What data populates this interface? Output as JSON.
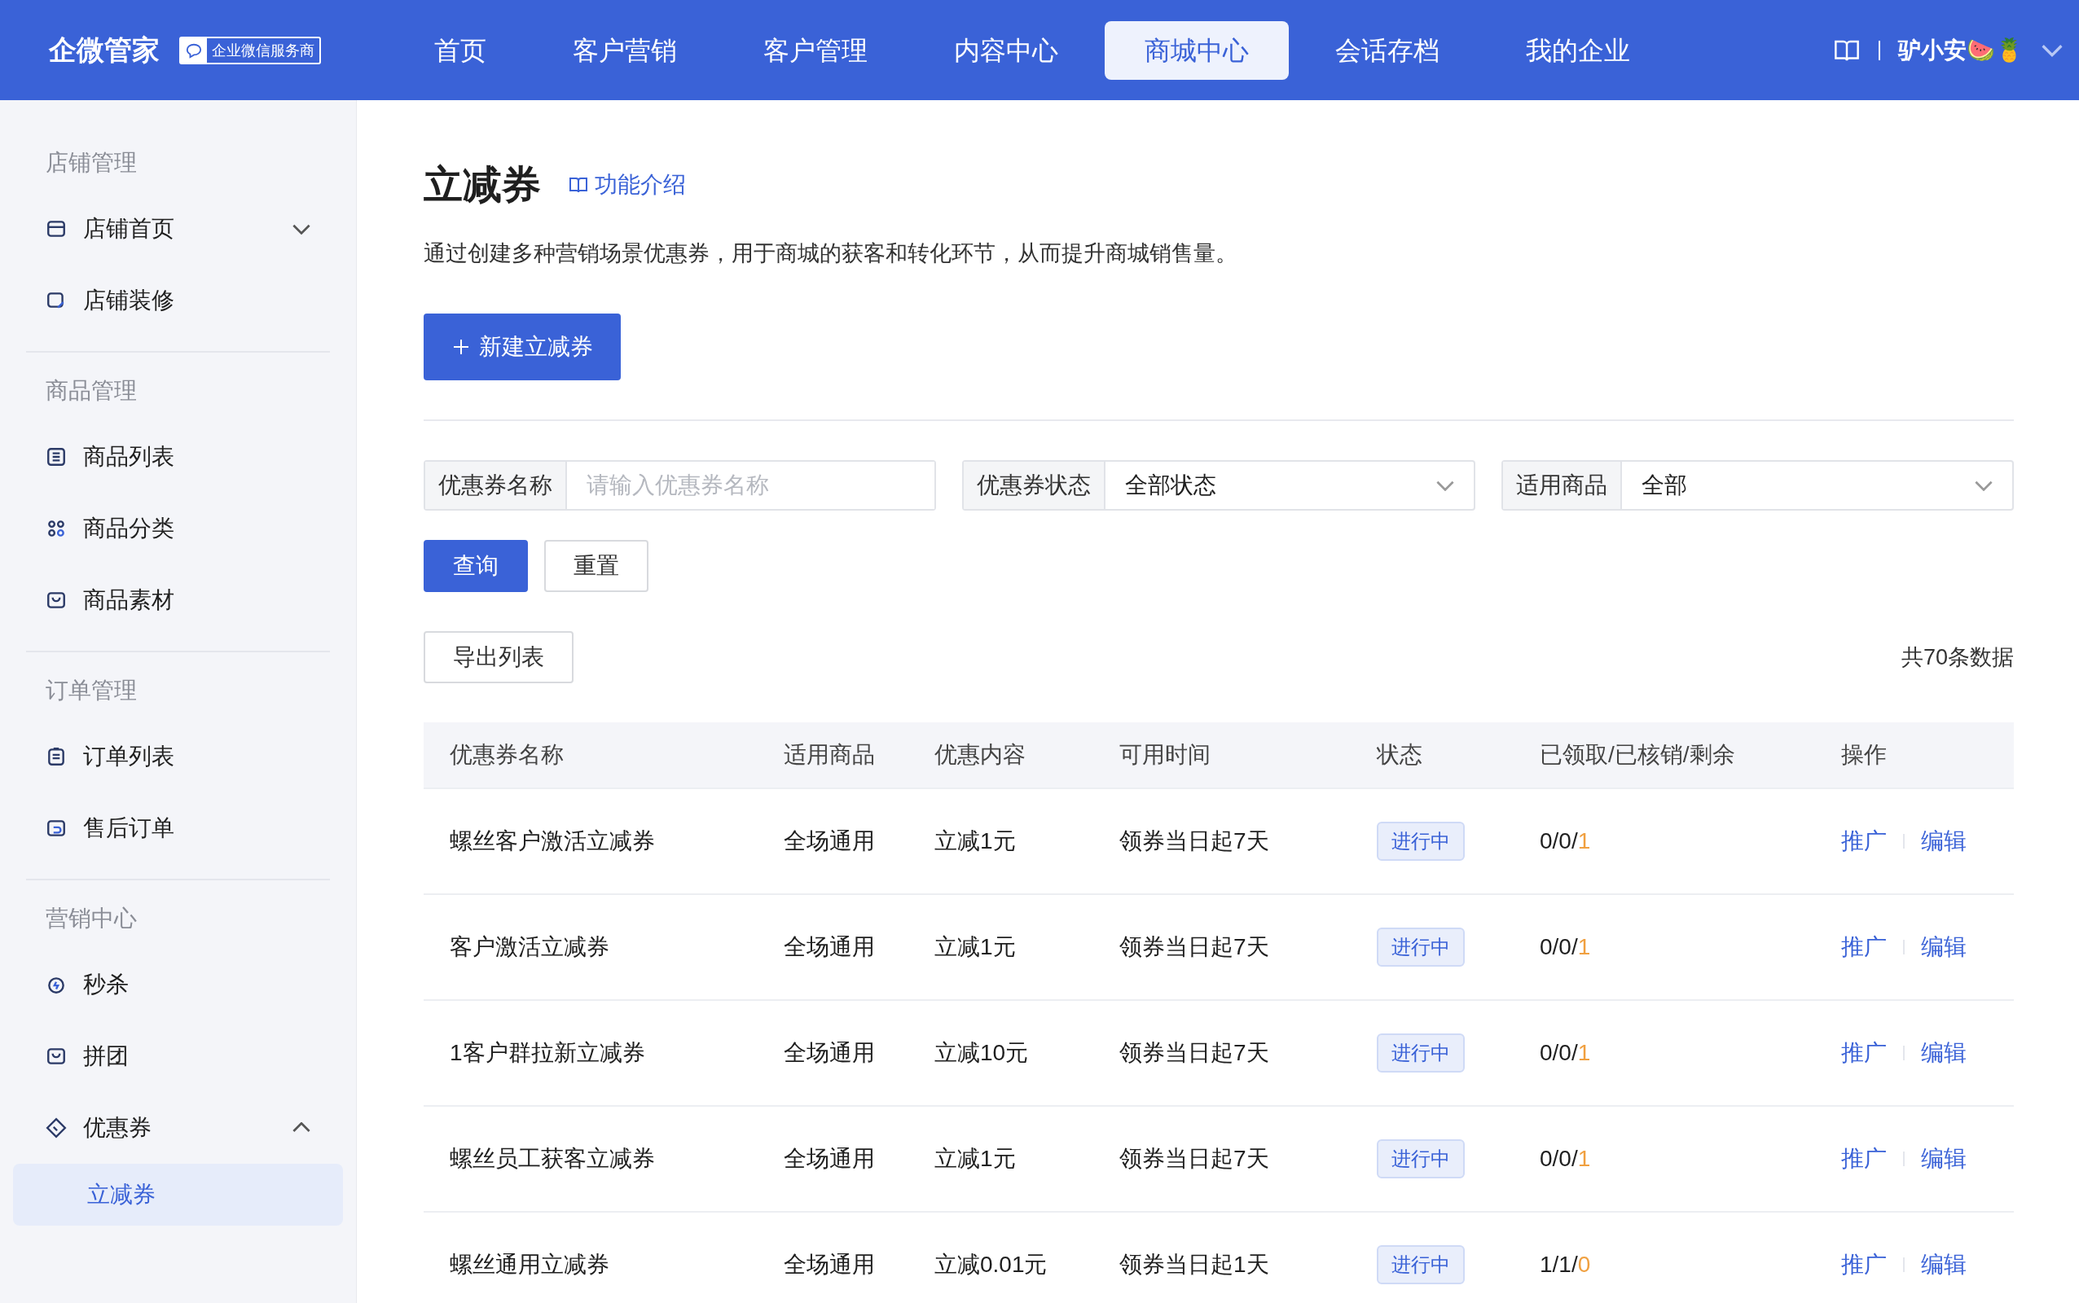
{
  "header": {
    "brand": "企微管家",
    "badge": "企业微信服务商",
    "nav": [
      {
        "label": "首页",
        "selected": false
      },
      {
        "label": "客户营销",
        "selected": false
      },
      {
        "label": "客户管理",
        "selected": false
      },
      {
        "label": "内容中心",
        "selected": false
      },
      {
        "label": "商城中心",
        "selected": true
      },
      {
        "label": "会话存档",
        "selected": false
      },
      {
        "label": "我的企业",
        "selected": false
      }
    ],
    "user": "驴小安🍉🍍"
  },
  "sidebar": {
    "sections": [
      {
        "title": "店铺管理",
        "items": [
          {
            "label": "店铺首页",
            "expanded": false
          },
          {
            "label": "店铺装修"
          }
        ]
      },
      {
        "title": "商品管理",
        "items": [
          {
            "label": "商品列表"
          },
          {
            "label": "商品分类"
          },
          {
            "label": "商品素材"
          }
        ]
      },
      {
        "title": "订单管理",
        "items": [
          {
            "label": "订单列表"
          },
          {
            "label": "售后订单"
          }
        ]
      },
      {
        "title": "营销中心",
        "items": [
          {
            "label": "秒杀"
          },
          {
            "label": "拼团"
          },
          {
            "label": "优惠券",
            "expanded": true,
            "children": [
              {
                "label": "立减券",
                "selected": true
              }
            ]
          }
        ]
      }
    ]
  },
  "page": {
    "title": "立减券",
    "intro_link": "功能介绍",
    "description": "通过创建多种营销场景优惠券，用于商城的获客和转化环节，从而提升商城销售量。",
    "create_button": "新建立减券",
    "filters": [
      {
        "label": "优惠券名称",
        "kind": "input",
        "placeholder": "请输入优惠券名称"
      },
      {
        "label": "优惠券状态",
        "kind": "select",
        "value": "全部状态"
      },
      {
        "label": "适用商品",
        "kind": "select",
        "value": "全部"
      }
    ],
    "query_button": "查询",
    "reset_button": "重置",
    "export_button": "导出列表",
    "total": "共70条数据",
    "table": {
      "columns": [
        "优惠券名称",
        "适用商品",
        "优惠内容",
        "可用时间",
        "状态",
        "已领取/已核销/剩余",
        "操作"
      ],
      "rows": [
        {
          "name": "螺丝客户激活立减券",
          "goods": "全场通用",
          "content": "立减1元",
          "time": "领券当日起7天",
          "status": "进行中",
          "usage": "0/0/",
          "remaining": "1",
          "actions": [
            "推广",
            "编辑"
          ]
        },
        {
          "name": "客户激活立减券",
          "goods": "全场通用",
          "content": "立减1元",
          "time": "领券当日起7天",
          "status": "进行中",
          "usage": "0/0/",
          "remaining": "1",
          "actions": [
            "推广",
            "编辑"
          ]
        },
        {
          "name": "1客户群拉新立减券",
          "goods": "全场通用",
          "content": "立减10元",
          "time": "领券当日起7天",
          "status": "进行中",
          "usage": "0/0/",
          "remaining": "1",
          "actions": [
            "推广",
            "编辑"
          ]
        },
        {
          "name": "螺丝员工获客立减券",
          "goods": "全场通用",
          "content": "立减1元",
          "time": "领券当日起7天",
          "status": "进行中",
          "usage": "0/0/",
          "remaining": "1",
          "actions": [
            "推广",
            "编辑"
          ]
        },
        {
          "name": "螺丝通用立减券",
          "goods": "全场通用",
          "content": "立减0.01元",
          "time": "领券当日起1天",
          "status": "进行中",
          "usage": "1/1/",
          "remaining": "0",
          "actions": [
            "推广",
            "编辑"
          ]
        }
      ]
    }
  }
}
